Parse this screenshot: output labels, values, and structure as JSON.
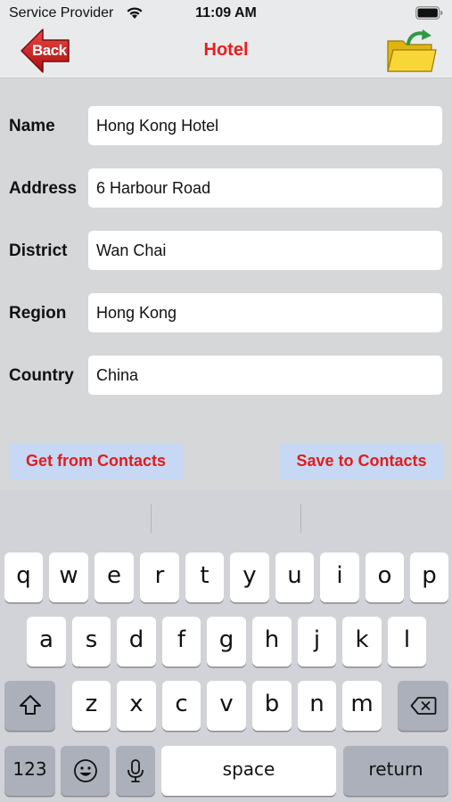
{
  "status": {
    "carrier": "Service Provider",
    "time": "11:09 AM"
  },
  "nav": {
    "back_label": "Back",
    "title": "Hotel"
  },
  "form": {
    "fields": [
      {
        "label": "Name",
        "value": "Hong Kong Hotel"
      },
      {
        "label": "Address",
        "value": "6 Harbour Road"
      },
      {
        "label": "District",
        "value": "Wan Chai"
      },
      {
        "label": "Region",
        "value": "Hong Kong"
      },
      {
        "label": "Country",
        "value": "China"
      }
    ],
    "get_contacts_label": "Get from Contacts",
    "save_contacts_label": "Save to Contacts"
  },
  "keyboard": {
    "row1": [
      "q",
      "w",
      "e",
      "r",
      "t",
      "y",
      "u",
      "i",
      "o",
      "p"
    ],
    "row2": [
      "a",
      "s",
      "d",
      "f",
      "g",
      "h",
      "j",
      "k",
      "l"
    ],
    "row3": [
      "z",
      "x",
      "c",
      "v",
      "b",
      "n",
      "m"
    ],
    "numbers_label": "123",
    "space_label": "space",
    "return_label": "return"
  },
  "colors": {
    "accent_red": "#ee1c1c",
    "button_bg": "#c6d8f4",
    "folder_yellow": "#f5d020",
    "arrow_green": "#3aa84a"
  }
}
